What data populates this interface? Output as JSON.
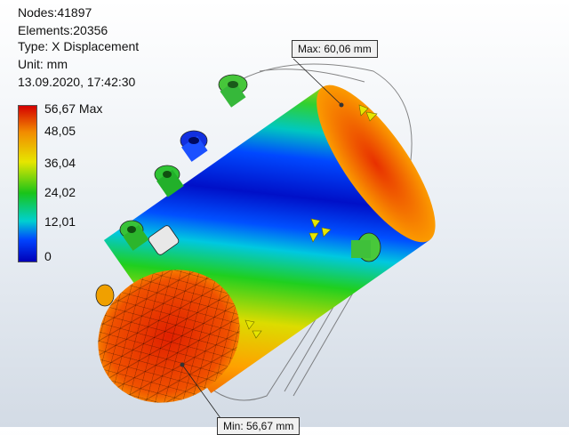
{
  "info": {
    "nodes": "Nodes:41897",
    "elements": "Elements:20356",
    "type": "Type: X Displacement",
    "unit": "Unit: mm",
    "timestamp": "13.09.2020, 17:42:30"
  },
  "legend": {
    "labels": [
      "56,67 Max",
      "48,05",
      "36,04",
      "24,02",
      "12,01",
      "0"
    ],
    "colors": [
      "#d40000",
      "#f28c00",
      "#e6e600",
      "#19c419",
      "#00d0d0",
      "#0044ff",
      "#0000b8"
    ]
  },
  "probes": {
    "max_label": "Max: 60,06 mm",
    "min_label": "Min: 56,67 mm"
  }
}
